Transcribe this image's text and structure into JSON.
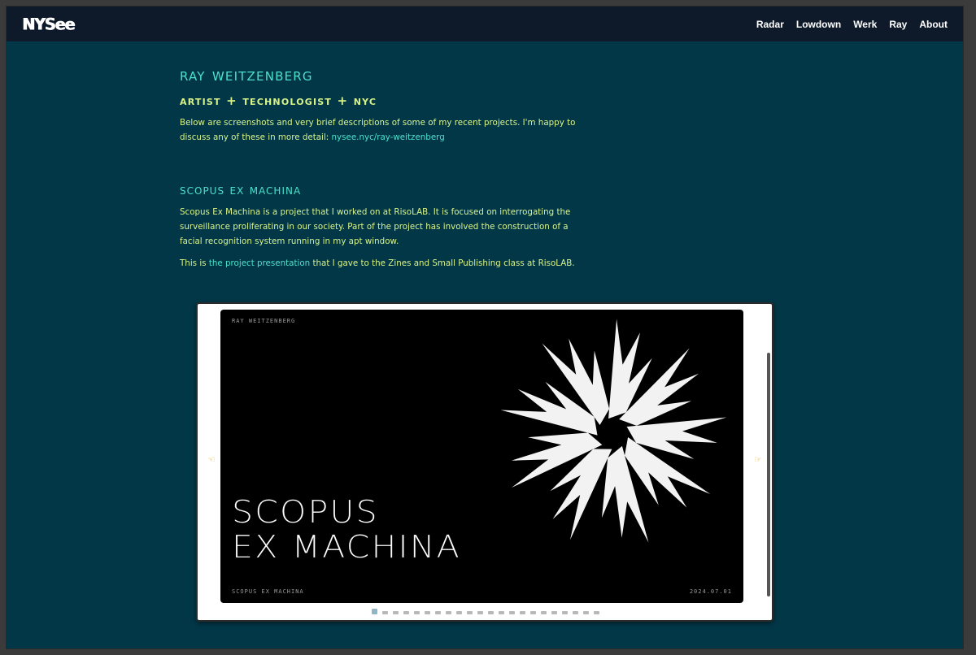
{
  "header": {
    "logo": "NYSee",
    "nav": [
      "Radar",
      "Lowdown",
      "Werk",
      "Ray",
      "About"
    ]
  },
  "intro": {
    "name": "Ray Weitzenberg",
    "tagline": "Artist + Technologist + NYC",
    "text": "Below are screenshots and very brief descriptions of some of my recent projects. I'm happy to discuss any of these in more detail:",
    "link": "nysee.nyc/ray-weitzenberg"
  },
  "project": {
    "title": "Scopus Ex Machina",
    "description": "Scopus Ex Machina is a project that I worked on at RisoLAB. It is focused on interrogating the surveillance proliferating in our society. Part of the project has involved the construction of a facial recognition system running in my apt window.",
    "presentation_prefix": "This is",
    "presentation_link": "the project presentation",
    "presentation_suffix": "that I gave to the Zines and Small Publishing class at RisoLAB."
  },
  "slide": {
    "author": "RAY WEITZENBERG",
    "title_line1": "SCOPUS",
    "title_line2": "EX MACHINA",
    "footer_left": "SCOPUS EX MACHINA",
    "footer_right": "2024.07.01",
    "prev_icon": "pointing-hand-left",
    "next_icon": "pointing-hand-right",
    "prev_glyph": "☜",
    "next_glyph": "☞",
    "thumbnail_count": 22
  },
  "colors": {
    "background": "#023748",
    "navbar": "#0e1a2a",
    "accent_teal": "#4de0cc",
    "accent_yellow": "#d8f38a"
  }
}
